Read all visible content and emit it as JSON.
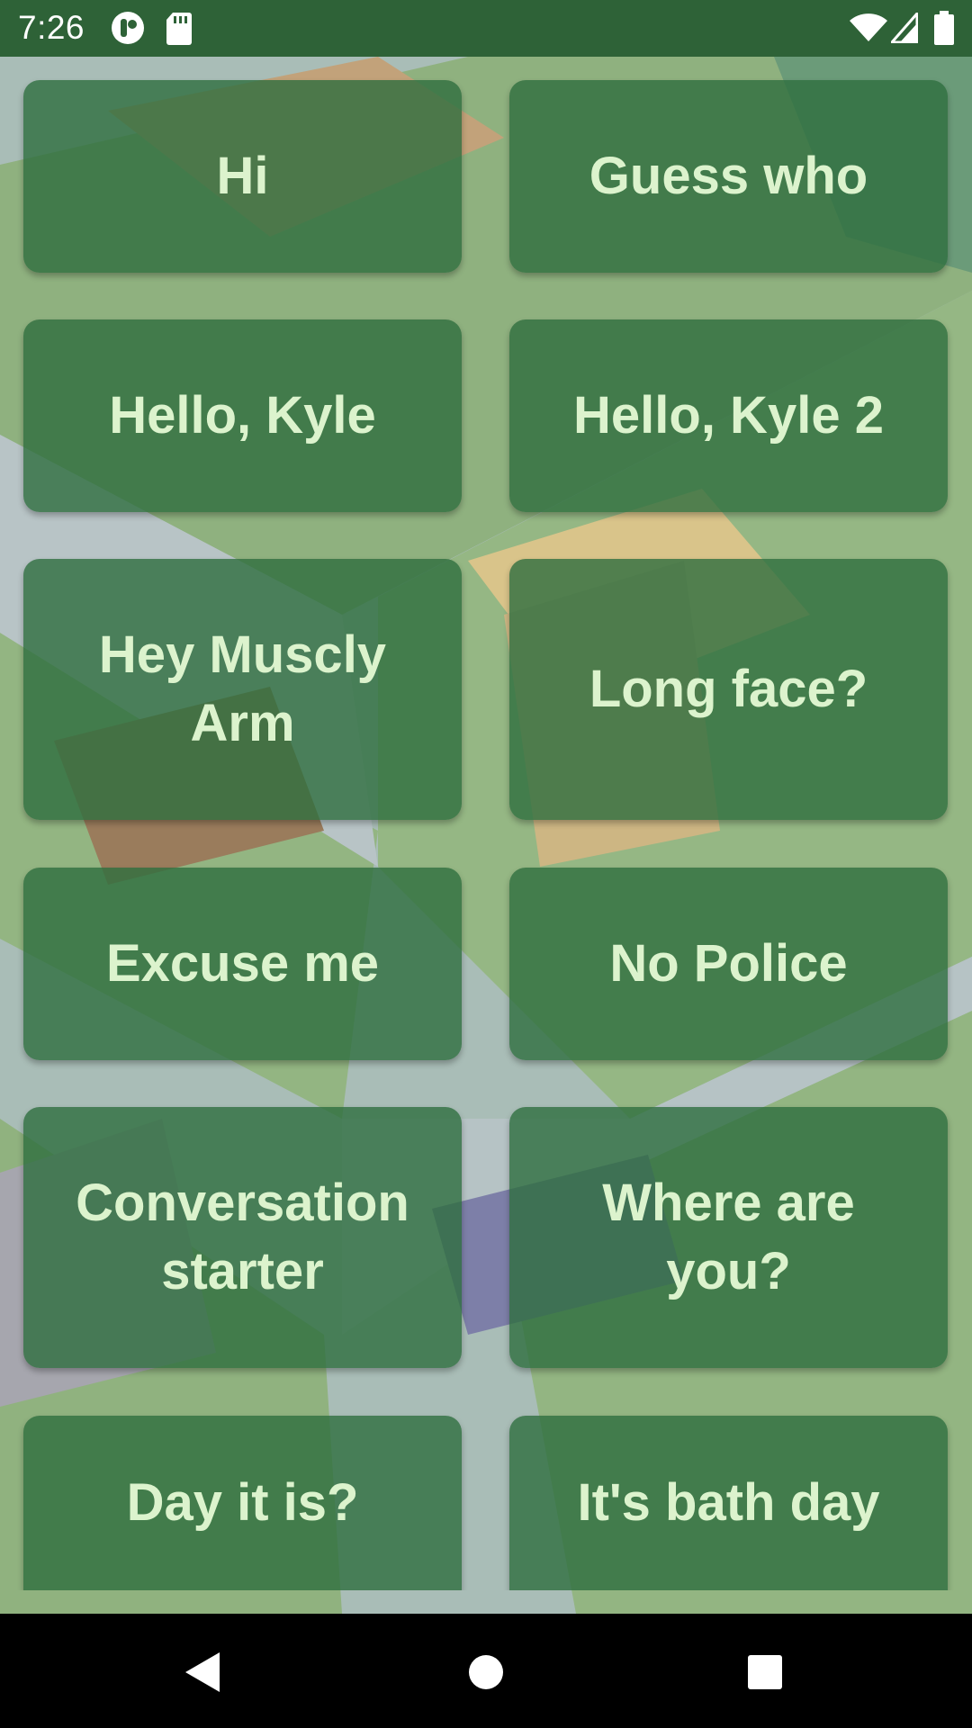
{
  "status_bar": {
    "time": "7:26",
    "left_icons": [
      "notification-app-icon",
      "sd-card-icon"
    ],
    "right_icons": [
      "wifi-icon",
      "signal-icon",
      "battery-icon"
    ],
    "color": "#2e6237"
  },
  "buttons": [
    {
      "label": "Hi"
    },
    {
      "label": "Guess who"
    },
    {
      "label": "Hello, Kyle"
    },
    {
      "label": "Hello, Kyle 2"
    },
    {
      "label": "Hey Muscly Arm"
    },
    {
      "label": "Long face?"
    },
    {
      "label": "Excuse me"
    },
    {
      "label": "No Police"
    },
    {
      "label": "Conversation starter"
    },
    {
      "label": "Where are you?"
    },
    {
      "label": "Day it is?"
    },
    {
      "label": "It's bath day"
    }
  ],
  "theme": {
    "tile_color": "#2e6e3e",
    "tile_text_color": "#dcf3cd"
  },
  "nav_bar": {
    "buttons": [
      "back-icon",
      "home-icon",
      "recents-icon"
    ]
  }
}
